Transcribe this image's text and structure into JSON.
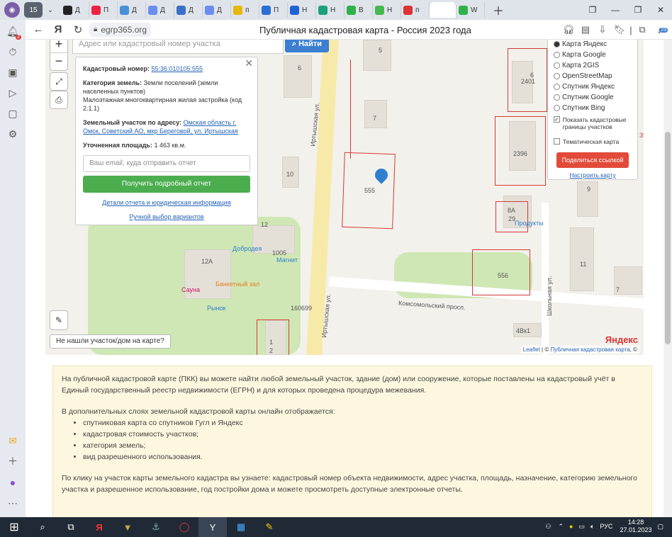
{
  "browser": {
    "tab_count": "15",
    "tabs": [
      "Д",
      "П",
      "Д",
      "Д",
      "Д",
      "Д",
      "п",
      "П",
      "Н",
      "Н",
      "В",
      "Н",
      "п",
      "",
      "W"
    ],
    "url": "egrp365.org",
    "page_title": "Публичная кадастровая карта - Россия 2023 года",
    "badge_count": "23"
  },
  "sidebar": {
    "notif_badge": "2"
  },
  "map": {
    "search_placeholder": "Адрес или кадастровый номер участка",
    "search_button": "Найти",
    "zoom_in": "+",
    "zoom_out": "−",
    "popup": {
      "cadnum_label": "Кадастровый номер:",
      "cadnum_value": "55:36:010105:555",
      "category_label": "Категория земель:",
      "category_value": "Земли поселений (земли населенных пунктов)",
      "use_value": "Малоэтажная многоквартирная жилая застройка (код 2.1.1)",
      "address_label": "Земельный участок по адресу:",
      "address_value": "Омская область г. Омск, Советский АО, мкр Береговой, ул. Иртышская",
      "area_label": "Уточненная площадь:",
      "area_value": "1 463 кв.м.",
      "email_placeholder": "Ваш email, куда отправить отчет",
      "report_button": "Получить подробный отчет",
      "details_link": "Детали отчета и юридическая информация",
      "manual_link": "Ручной выбор вариантов"
    },
    "layers": {
      "options": [
        "Карта Яндекс",
        "Карта Google",
        "Карта 2GIS",
        "OpenStreetMap",
        "Спутник Яндекс",
        "Спутник Google",
        "Спутник Bing"
      ],
      "selected": "Карта Яндекс",
      "show_cadastral": "Показать кадастровые границы участков",
      "thematic": "Тематическая карта",
      "share_button": "Поделиться ссылкой",
      "configure_link": "Настроить карту"
    },
    "labels": {
      "street_irtysh": "Иртышская ул.",
      "street_komsomol": "Комсомольский просп.",
      "street_school": "Школьная ул.",
      "dobrodeya": "Добродея",
      "magnit": "Магнит",
      "sauna": "Сауна",
      "banquet": "Банкетный зал",
      "market": "Рынок",
      "produkty": "Продукты",
      "p555": "555",
      "p2401": "2401",
      "p2396": "2396",
      "p556": "556",
      "p1005": "1005",
      "p160699": "160699",
      "p29": "29",
      "h5": "5",
      "h6": "6",
      "h6b": "6",
      "h7": "7",
      "h10": "10",
      "h12": "12",
      "h12a": "12А",
      "h8a": "8А",
      "h9": "9",
      "h11": "11",
      "h7b": "7",
      "h4bk1": "4Вк1",
      "h1": "1",
      "h2": "2",
      "h39": "39"
    },
    "not_found": "Не нашли участок/дом на карте?",
    "attribution_leaflet": "Leaflet",
    "attribution_data": "Публичная кадастровая карта",
    "attribution_rest": "| © ",
    "attribution_end": ", ©",
    "yandex_logo": "Яндекс"
  },
  "info": {
    "p1": "На публичной кадастровой карте (ПКК) вы можете найти любой земельный участок, здание (дом) или сооружение, которые поставлены на кадастровый учёт в Единый государственный реестр недвижимости (ЕГРН) и для которых проведена процедура межевания.",
    "p2": "В дополнительных слоях земельной кадастровой карты онлайн отображается:",
    "list": [
      "спутниковая карта со спутников Гугл и Яндекс",
      "кадастровая стоимость участков;",
      "категория земель;",
      "вид разрешенного использования."
    ],
    "p3": "По клику на участок карты земельного кадастра вы узнаете: кадастровый номер объекта недвижимости, адрес участка, площадь, назначение, категорию земельного участка и разрешенное использование, год постройки дома и можете просмотреть доступные электронные отчеты."
  },
  "taskbar": {
    "lang": "РУС",
    "time": "14:28",
    "date": "27.01.2023"
  }
}
